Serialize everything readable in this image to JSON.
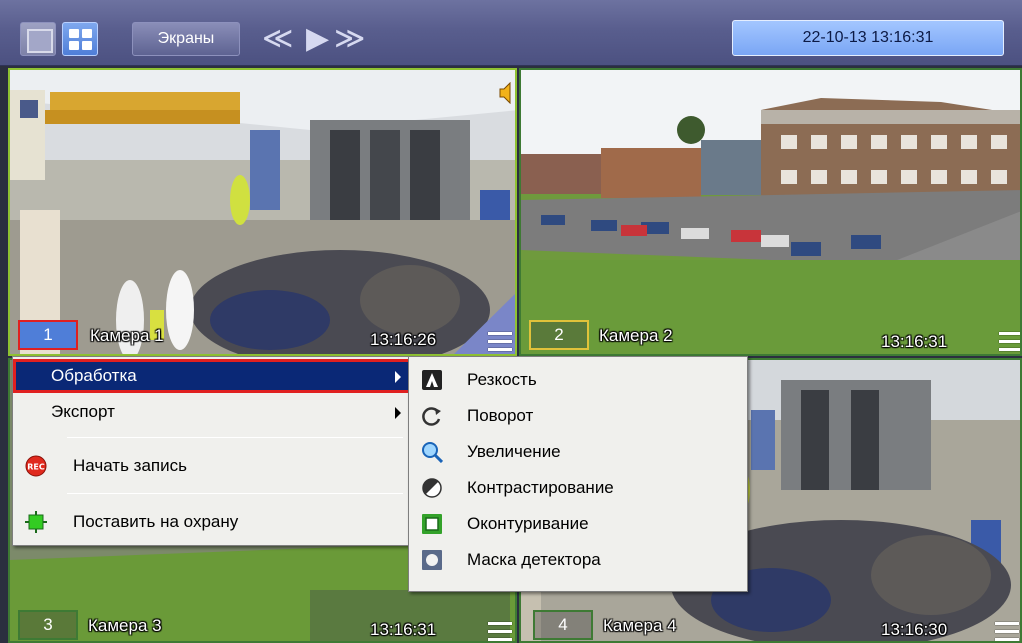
{
  "toolbar": {
    "screens_label": "Экраны",
    "datetime": "22-10-13   13:16:31",
    "icons": [
      "layout-single-icon",
      "layout-quad-icon",
      "rewind-icon",
      "play-icon",
      "fast-forward-icon"
    ],
    "nav_glyphs": {
      "rewind": "≪",
      "play": "▶",
      "forward": "≫"
    }
  },
  "cameras": [
    {
      "number": "1",
      "name": "Камера 1",
      "time": "13:16:26"
    },
    {
      "number": "2",
      "name": "Камера 2",
      "time": "13:16:31"
    },
    {
      "number": "3",
      "name": "Камера 3",
      "time": "13:16:31"
    },
    {
      "number": "4",
      "name": "Камера 4",
      "time": "13:16:30"
    }
  ],
  "context_menu": {
    "items": [
      {
        "label": "Обработка",
        "has_submenu": true,
        "selected": true
      },
      {
        "label": "Экспорт",
        "has_submenu": true
      },
      {
        "label": "Начать запись",
        "icon": "record-icon"
      },
      {
        "label": "Поставить на охрану",
        "icon": "arm-icon"
      }
    ]
  },
  "submenu": {
    "items": [
      {
        "label": "Резкость",
        "icon": "sharpness-icon"
      },
      {
        "label": "Поворот",
        "icon": "rotate-icon"
      },
      {
        "label": "Увеличение",
        "icon": "zoom-icon"
      },
      {
        "label": "Контрастирование",
        "icon": "contrast-icon"
      },
      {
        "label": "Оконтуривание",
        "icon": "outline-icon"
      },
      {
        "label": "Маска детектора",
        "icon": "detector-mask-icon"
      }
    ]
  },
  "colors": {
    "toolbar": "#5a5f8f",
    "active_border": "#8fc232",
    "menu_highlight": "#0a2876",
    "highlight_outline": "#e02020",
    "datetime_bg": "#8fb5fa"
  }
}
